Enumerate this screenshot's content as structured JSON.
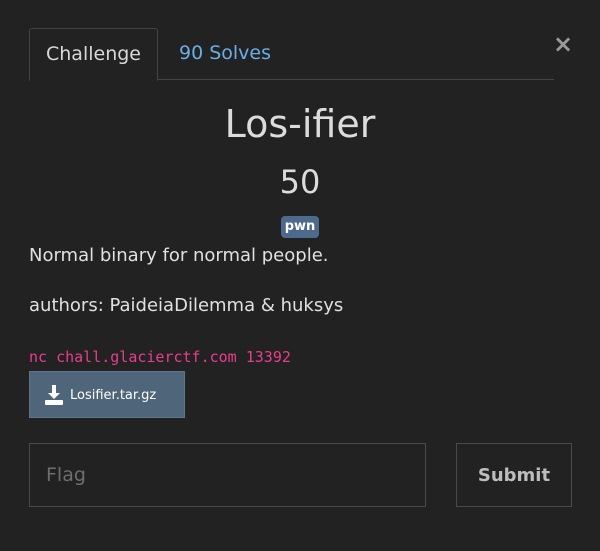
{
  "modal": {
    "close_label": "×",
    "tabs": [
      {
        "label": "Challenge",
        "active": true
      },
      {
        "label": "90 Solves",
        "active": false
      }
    ],
    "challenge": {
      "name": "Los-ifier",
      "value": "50",
      "tags": [
        "pwn"
      ],
      "description_lines": [
        "Normal binary for normal people.",
        "authors: PaideiaDilemma & huksys"
      ],
      "connection": "nc chall.glacierctf.com 13392",
      "files": [
        {
          "name": "Losifier.tar.gz",
          "icon": "download-icon"
        }
      ]
    },
    "flag_form": {
      "placeholder": "Flag",
      "value": "",
      "submit_label": "Submit"
    }
  },
  "colors": {
    "background": "#222222",
    "link": "#6aaee8",
    "tag_bg": "#4d6a8c",
    "code": "#e83e8c",
    "file_button": "#4f6579"
  }
}
